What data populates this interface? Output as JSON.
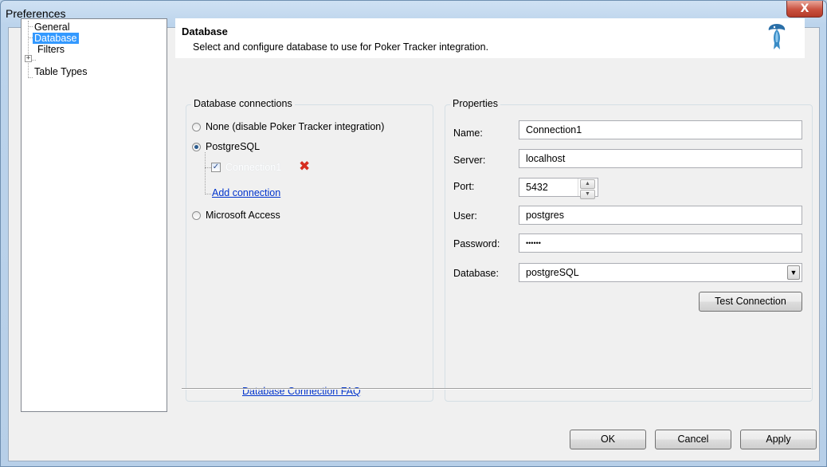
{
  "window": {
    "title": "Preferences",
    "close_glyph": "X"
  },
  "tree": {
    "items": [
      {
        "label": "General"
      },
      {
        "label": "Database"
      },
      {
        "label": "Filters",
        "expander": "+"
      },
      {
        "label": "Table Types"
      }
    ]
  },
  "header": {
    "title": "Database",
    "description": "Select and configure database to use for Poker Tracker integration.",
    "icon": "fish-logo-icon"
  },
  "connections": {
    "group_title": "Database connections",
    "options": [
      {
        "label": "None (disable Poker Tracker integration)",
        "checked": false
      },
      {
        "label": "PostgreSQL",
        "checked": true
      },
      {
        "label": "Microsoft Access",
        "checked": false
      }
    ],
    "connection_item": "Connection1",
    "add_connection": "Add connection",
    "faq_link": "Database Connection FAQ"
  },
  "properties": {
    "group_title": "Properties",
    "name_label": "Name:",
    "name_value": "Connection1",
    "server_label": "Server:",
    "server_value": "localhost",
    "port_label": "Port:",
    "port_value": "5432",
    "user_label": "User:",
    "user_value": "postgres",
    "password_label": "Password:",
    "password_value": "••••••",
    "database_label": "Database:",
    "database_value": "postgreSQL",
    "test_button": "Test Connection"
  },
  "buttons": {
    "ok": "OK",
    "cancel": "Cancel",
    "apply": "Apply"
  }
}
